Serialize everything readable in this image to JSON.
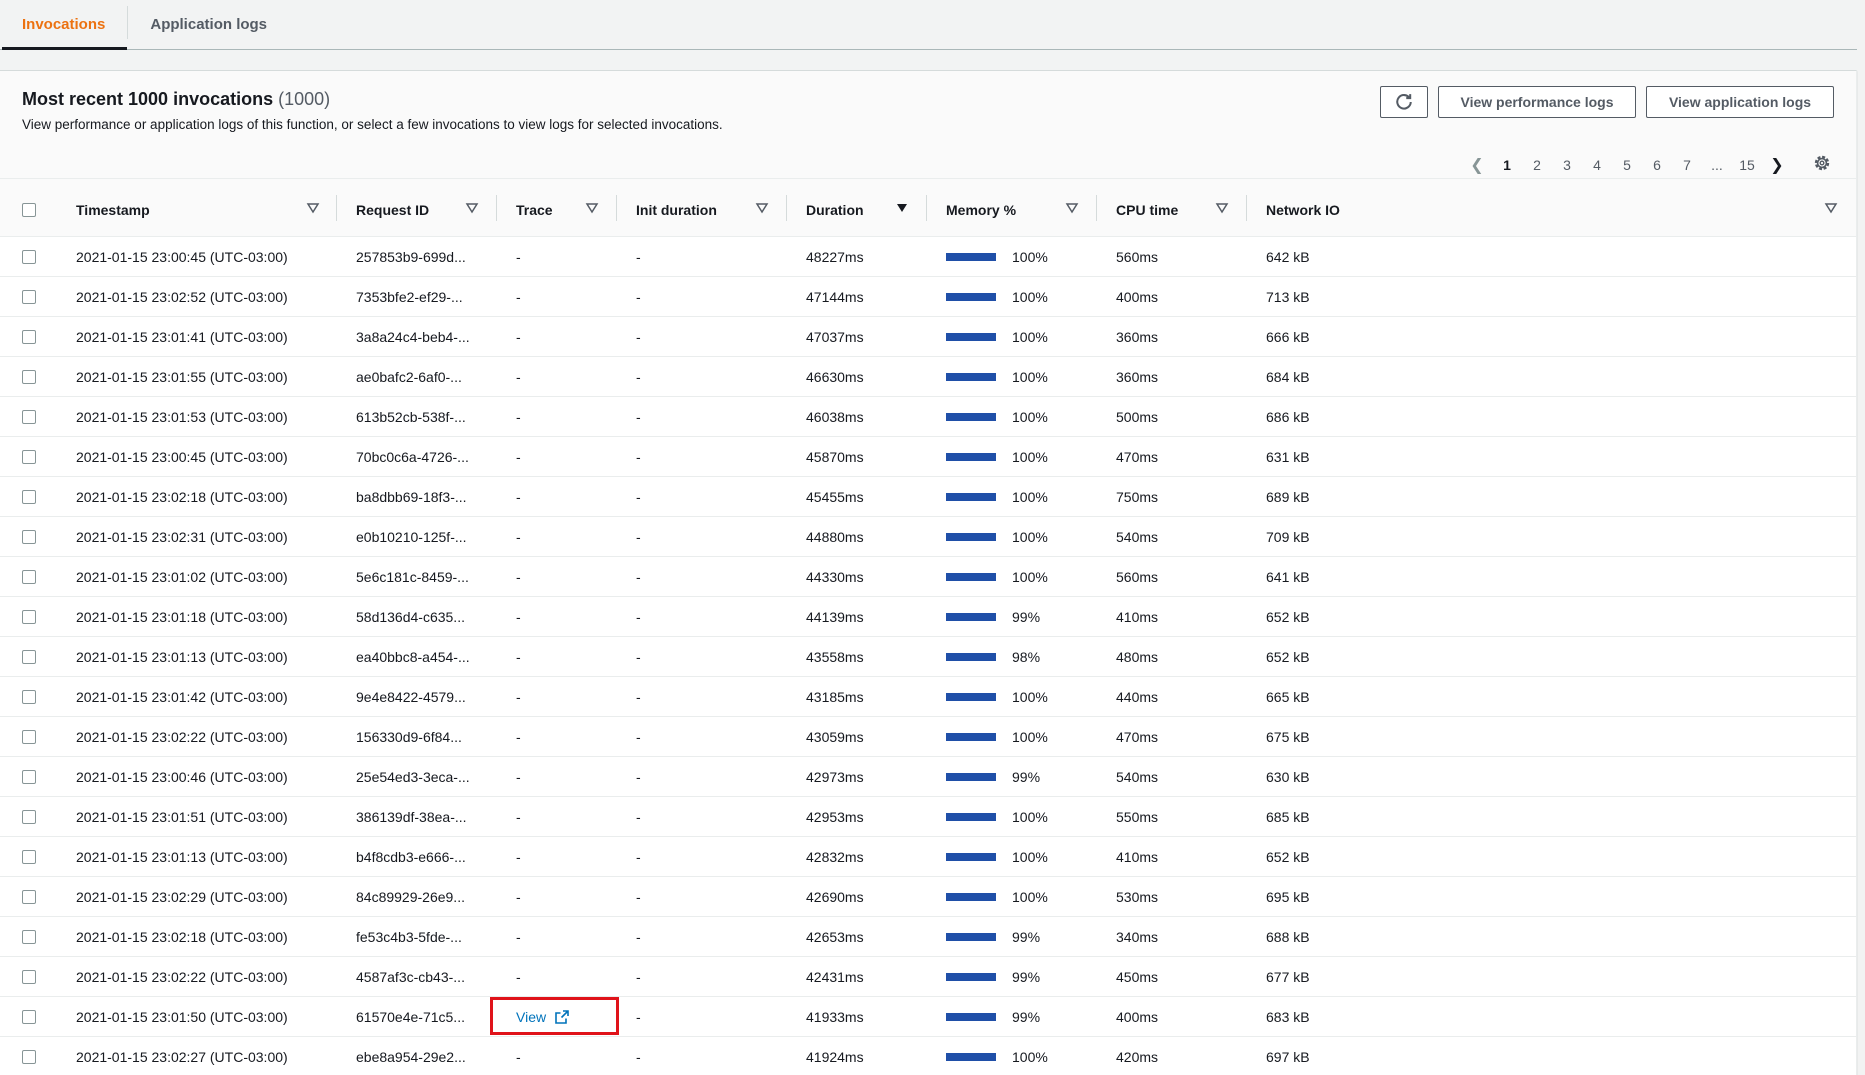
{
  "tabs": [
    {
      "label": "Invocations",
      "active": true
    },
    {
      "label": "Application logs",
      "active": false
    }
  ],
  "panel": {
    "title": "Most recent 1000 invocations",
    "title_count": "(1000)",
    "description": "View performance or application logs of this function, or select a few invocations to view logs for selected invocations.",
    "buttons": {
      "refresh_icon": "refresh-icon",
      "view_performance_logs": "View performance logs",
      "view_application_logs": "View application logs"
    }
  },
  "pagination": {
    "pages": [
      "1",
      "2",
      "3",
      "4",
      "5",
      "6",
      "7",
      "...",
      "15"
    ],
    "current": "1"
  },
  "table": {
    "columns": [
      "Timestamp",
      "Request ID",
      "Trace",
      "Init duration",
      "Duration",
      "Memory %",
      "CPU time",
      "Network IO"
    ],
    "sorted_column": "Duration",
    "memory_bar_color": "#1f4fa8",
    "rows": [
      {
        "timestamp": "2021-01-15 23:00:45 (UTC-03:00)",
        "request_id": "257853b9-699d...",
        "trace": "-",
        "init": "-",
        "duration": "48227ms",
        "memory": "100%",
        "cpu": "560ms",
        "network": "642 kB"
      },
      {
        "timestamp": "2021-01-15 23:02:52 (UTC-03:00)",
        "request_id": "7353bfe2-ef29-...",
        "trace": "-",
        "init": "-",
        "duration": "47144ms",
        "memory": "100%",
        "cpu": "400ms",
        "network": "713 kB"
      },
      {
        "timestamp": "2021-01-15 23:01:41 (UTC-03:00)",
        "request_id": "3a8a24c4-beb4-...",
        "trace": "-",
        "init": "-",
        "duration": "47037ms",
        "memory": "100%",
        "cpu": "360ms",
        "network": "666 kB"
      },
      {
        "timestamp": "2021-01-15 23:01:55 (UTC-03:00)",
        "request_id": "ae0bafc2-6af0-...",
        "trace": "-",
        "init": "-",
        "duration": "46630ms",
        "memory": "100%",
        "cpu": "360ms",
        "network": "684 kB"
      },
      {
        "timestamp": "2021-01-15 23:01:53 (UTC-03:00)",
        "request_id": "613b52cb-538f-...",
        "trace": "-",
        "init": "-",
        "duration": "46038ms",
        "memory": "100%",
        "cpu": "500ms",
        "network": "686 kB"
      },
      {
        "timestamp": "2021-01-15 23:00:45 (UTC-03:00)",
        "request_id": "70bc0c6a-4726-...",
        "trace": "-",
        "init": "-",
        "duration": "45870ms",
        "memory": "100%",
        "cpu": "470ms",
        "network": "631 kB"
      },
      {
        "timestamp": "2021-01-15 23:02:18 (UTC-03:00)",
        "request_id": "ba8dbb69-18f3-...",
        "trace": "-",
        "init": "-",
        "duration": "45455ms",
        "memory": "100%",
        "cpu": "750ms",
        "network": "689 kB"
      },
      {
        "timestamp": "2021-01-15 23:02:31 (UTC-03:00)",
        "request_id": "e0b10210-125f-...",
        "trace": "-",
        "init": "-",
        "duration": "44880ms",
        "memory": "100%",
        "cpu": "540ms",
        "network": "709 kB"
      },
      {
        "timestamp": "2021-01-15 23:01:02 (UTC-03:00)",
        "request_id": "5e6c181c-8459-...",
        "trace": "-",
        "init": "-",
        "duration": "44330ms",
        "memory": "100%",
        "cpu": "560ms",
        "network": "641 kB"
      },
      {
        "timestamp": "2021-01-15 23:01:18 (UTC-03:00)",
        "request_id": "58d136d4-c635...",
        "trace": "-",
        "init": "-",
        "duration": "44139ms",
        "memory": "99%",
        "cpu": "410ms",
        "network": "652 kB"
      },
      {
        "timestamp": "2021-01-15 23:01:13 (UTC-03:00)",
        "request_id": "ea40bbc8-a454-...",
        "trace": "-",
        "init": "-",
        "duration": "43558ms",
        "memory": "98%",
        "cpu": "480ms",
        "network": "652 kB"
      },
      {
        "timestamp": "2021-01-15 23:01:42 (UTC-03:00)",
        "request_id": "9e4e8422-4579...",
        "trace": "-",
        "init": "-",
        "duration": "43185ms",
        "memory": "100%",
        "cpu": "440ms",
        "network": "665 kB"
      },
      {
        "timestamp": "2021-01-15 23:02:22 (UTC-03:00)",
        "request_id": "156330d9-6f84...",
        "trace": "-",
        "init": "-",
        "duration": "43059ms",
        "memory": "100%",
        "cpu": "470ms",
        "network": "675 kB"
      },
      {
        "timestamp": "2021-01-15 23:00:46 (UTC-03:00)",
        "request_id": "25e54ed3-3eca-...",
        "trace": "-",
        "init": "-",
        "duration": "42973ms",
        "memory": "99%",
        "cpu": "540ms",
        "network": "630 kB"
      },
      {
        "timestamp": "2021-01-15 23:01:51 (UTC-03:00)",
        "request_id": "386139df-38ea-...",
        "trace": "-",
        "init": "-",
        "duration": "42953ms",
        "memory": "100%",
        "cpu": "550ms",
        "network": "685 kB"
      },
      {
        "timestamp": "2021-01-15 23:01:13 (UTC-03:00)",
        "request_id": "b4f8cdb3-e666-...",
        "trace": "-",
        "init": "-",
        "duration": "42832ms",
        "memory": "100%",
        "cpu": "410ms",
        "network": "652 kB"
      },
      {
        "timestamp": "2021-01-15 23:02:29 (UTC-03:00)",
        "request_id": "84c89929-26e9...",
        "trace": "-",
        "init": "-",
        "duration": "42690ms",
        "memory": "100%",
        "cpu": "530ms",
        "network": "695 kB"
      },
      {
        "timestamp": "2021-01-15 23:02:18 (UTC-03:00)",
        "request_id": "fe53c4b3-5fde-...",
        "trace": "-",
        "init": "-",
        "duration": "42653ms",
        "memory": "99%",
        "cpu": "340ms",
        "network": "688 kB"
      },
      {
        "timestamp": "2021-01-15 23:02:22 (UTC-03:00)",
        "request_id": "4587af3c-cb43-...",
        "trace": "-",
        "init": "-",
        "duration": "42431ms",
        "memory": "99%",
        "cpu": "450ms",
        "network": "677 kB"
      },
      {
        "timestamp": "2021-01-15 23:01:50 (UTC-03:00)",
        "request_id": "61570e4e-71c5...",
        "trace": "View",
        "trace_link": true,
        "init": "-",
        "duration": "41933ms",
        "memory": "99%",
        "cpu": "400ms",
        "network": "683 kB"
      },
      {
        "timestamp": "2021-01-15 23:02:27 (UTC-03:00)",
        "request_id": "ebe8a954-29e2...",
        "trace": "-",
        "init": "-",
        "duration": "41924ms",
        "memory": "100%",
        "cpu": "420ms",
        "network": "697 kB"
      }
    ]
  }
}
